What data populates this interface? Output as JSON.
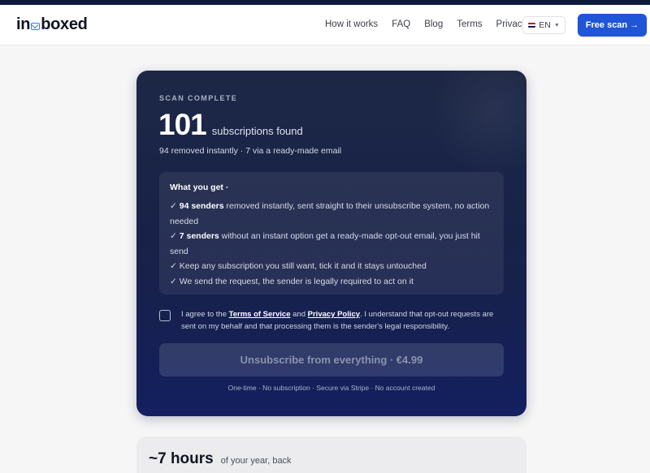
{
  "brand": {
    "logo_prefix": "in",
    "logo_suffix": "boxed",
    "logo_icon": "envelope-icon",
    "accent": "#1f55d6"
  },
  "nav": {
    "links": [
      "How it works",
      "FAQ",
      "Blog",
      "Terms",
      "Privacy"
    ],
    "language": "EN",
    "cta_label": "Free scan →"
  },
  "result": {
    "eyebrow": "SCAN COMPLETE",
    "count": "101",
    "count_label": "subscriptions found",
    "breakdown": "94 removed instantly · 7 via a ready-made email"
  },
  "benefits": {
    "title": "What you get ·",
    "items": [
      {
        "check": "✓",
        "bold": "94 senders",
        "text": " removed instantly, sent straight to their unsubscribe system, no action needed"
      },
      {
        "check": "✓",
        "bold": "7 senders",
        "text": " without an instant option get a ready-made opt-out email, you just hit send"
      },
      {
        "check": "✓",
        "bold": "",
        "text": "Keep any subscription you still want, tick it and it stays untouched"
      },
      {
        "check": "✓",
        "bold": "",
        "text": "We send the request, the sender is legally required to act on it"
      }
    ]
  },
  "consent": {
    "checked": false,
    "prefix": "I agree to the ",
    "terms_link": "Terms of Service",
    "and": " and ",
    "privacy_link": "Privacy Policy",
    "suffix": ". I understand that opt-out requests are sent on my behalf and that processing them is the sender's legal responsibility."
  },
  "purchase": {
    "button_label": "Unsubscribe from everything · €4.99",
    "fine_print": "One-time · No subscription · Secure via Stripe · No account created"
  },
  "savings": {
    "value": "~7 hours",
    "label": "of your year, back"
  }
}
